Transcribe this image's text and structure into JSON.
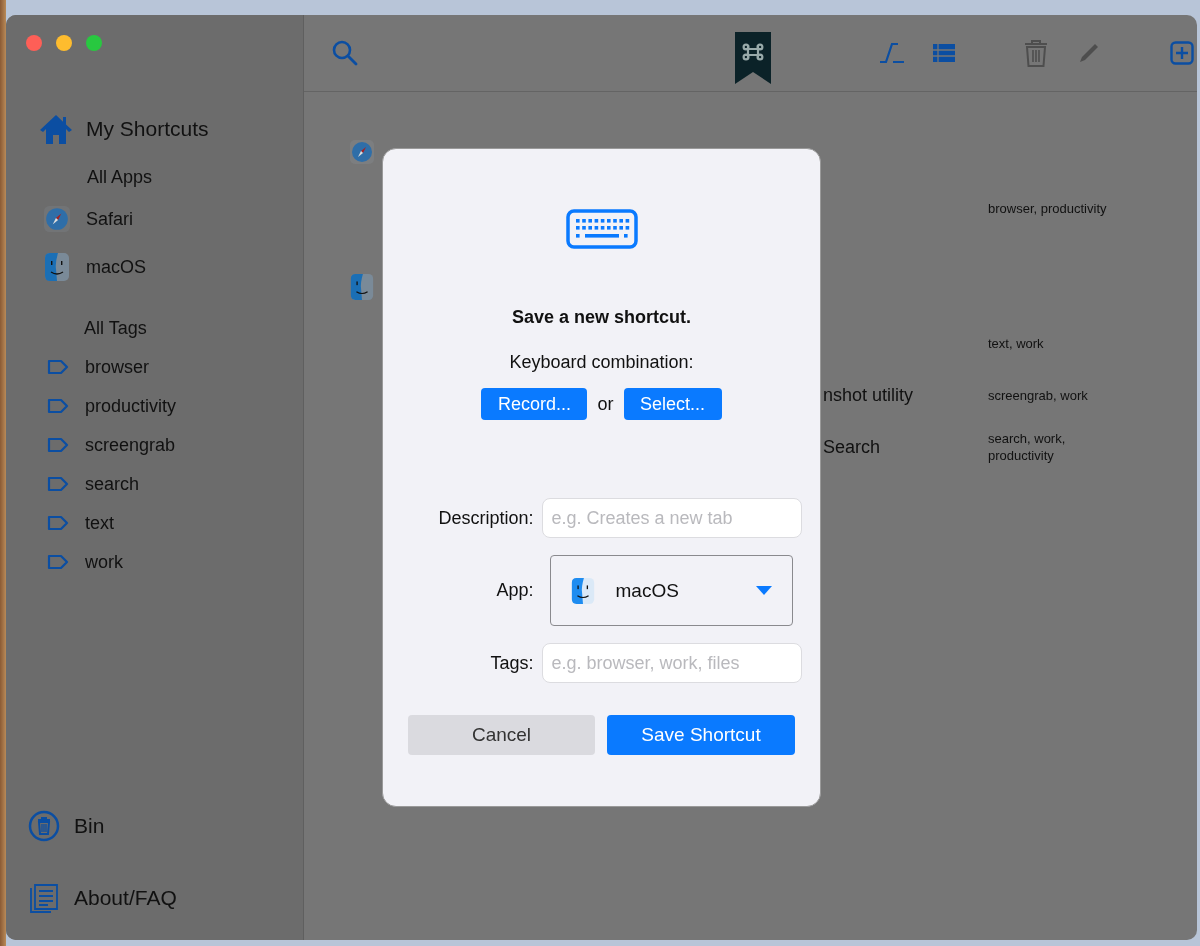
{
  "sidebar": {
    "home": {
      "label": "My Shortcuts"
    },
    "apps_header": "All Apps",
    "apps": [
      {
        "label": "Safari",
        "kind": "compass"
      },
      {
        "label": "macOS",
        "kind": "finder"
      }
    ],
    "tags_header": "All Tags",
    "tags": [
      "browser",
      "productivity",
      "screengrab",
      "search",
      "text",
      "work"
    ],
    "footer": [
      {
        "label": "Bin",
        "kind": "bin"
      },
      {
        "label": "About/FAQ",
        "kind": "about"
      }
    ]
  },
  "toolbar": [
    {
      "kind": "search",
      "disabled": false
    },
    {
      "kind": "logo",
      "disabled": false
    },
    {
      "kind": "curve",
      "disabled": false
    },
    {
      "kind": "list",
      "disabled": false
    },
    {
      "kind": "trash",
      "disabled": true
    },
    {
      "kind": "pencil",
      "disabled": true
    },
    {
      "kind": "add",
      "disabled": false
    }
  ],
  "groups": [
    {
      "kind": "compass",
      "rows": [
        {
          "tags": "browser, productivity"
        }
      ]
    },
    {
      "kind": "finder",
      "rows": [
        {
          "tags": "text, work"
        },
        {
          "description": "nshot utility",
          "tags": "screengrab, work"
        },
        {
          "description": "Search",
          "tags": "search, work, productivity"
        }
      ]
    }
  ],
  "dialog": {
    "title": "Save a new shortcut.",
    "combination_label": "Keyboard combination:",
    "record_button": "Record...",
    "or": "or",
    "select_button": "Select...",
    "fields": [
      {
        "kind": "text",
        "label": "Description:",
        "placeholder": "e.g. Creates a new tab"
      },
      {
        "kind": "select",
        "label": "App:",
        "value": "macOS"
      },
      {
        "kind": "text",
        "label": "Tags:",
        "placeholder": "e.g. browser, work, files"
      }
    ],
    "cancel_button": "Cancel",
    "save_button": "Save Shortcut"
  }
}
